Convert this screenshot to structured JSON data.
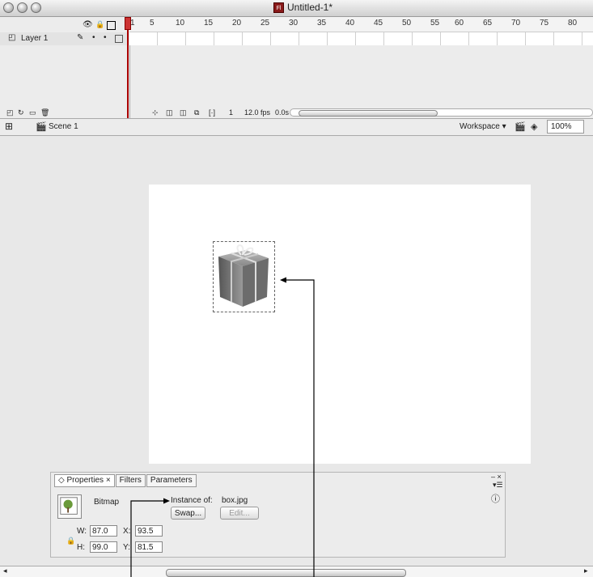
{
  "window": {
    "title": "Untitled-1*",
    "app_icon": "Fl"
  },
  "timeline": {
    "ruler_labels": [
      "1",
      "5",
      "10",
      "15",
      "20",
      "25",
      "30",
      "35",
      "40",
      "45",
      "50",
      "55",
      "60",
      "65",
      "70",
      "75",
      "80"
    ],
    "layer_name": "Layer 1",
    "frame_number": "1",
    "fps": "12.0 fps",
    "time": "0.0s"
  },
  "editbar": {
    "scene": "Scene 1",
    "workspace": "Workspace ▾",
    "zoom": "100%"
  },
  "properties": {
    "tabs": [
      "Properties ×",
      "Filters",
      "Parameters"
    ],
    "type": "Bitmap",
    "instance_label": "Instance of:",
    "instance_value": "box.jpg",
    "swap_label": "Swap...",
    "edit_label": "Edit...",
    "w_label": "W:",
    "w_value": "87.0",
    "h_label": "H:",
    "h_value": "99.0",
    "x_label": "X:",
    "x_value": "93.5",
    "y_label": "Y:",
    "y_value": "81.5"
  }
}
